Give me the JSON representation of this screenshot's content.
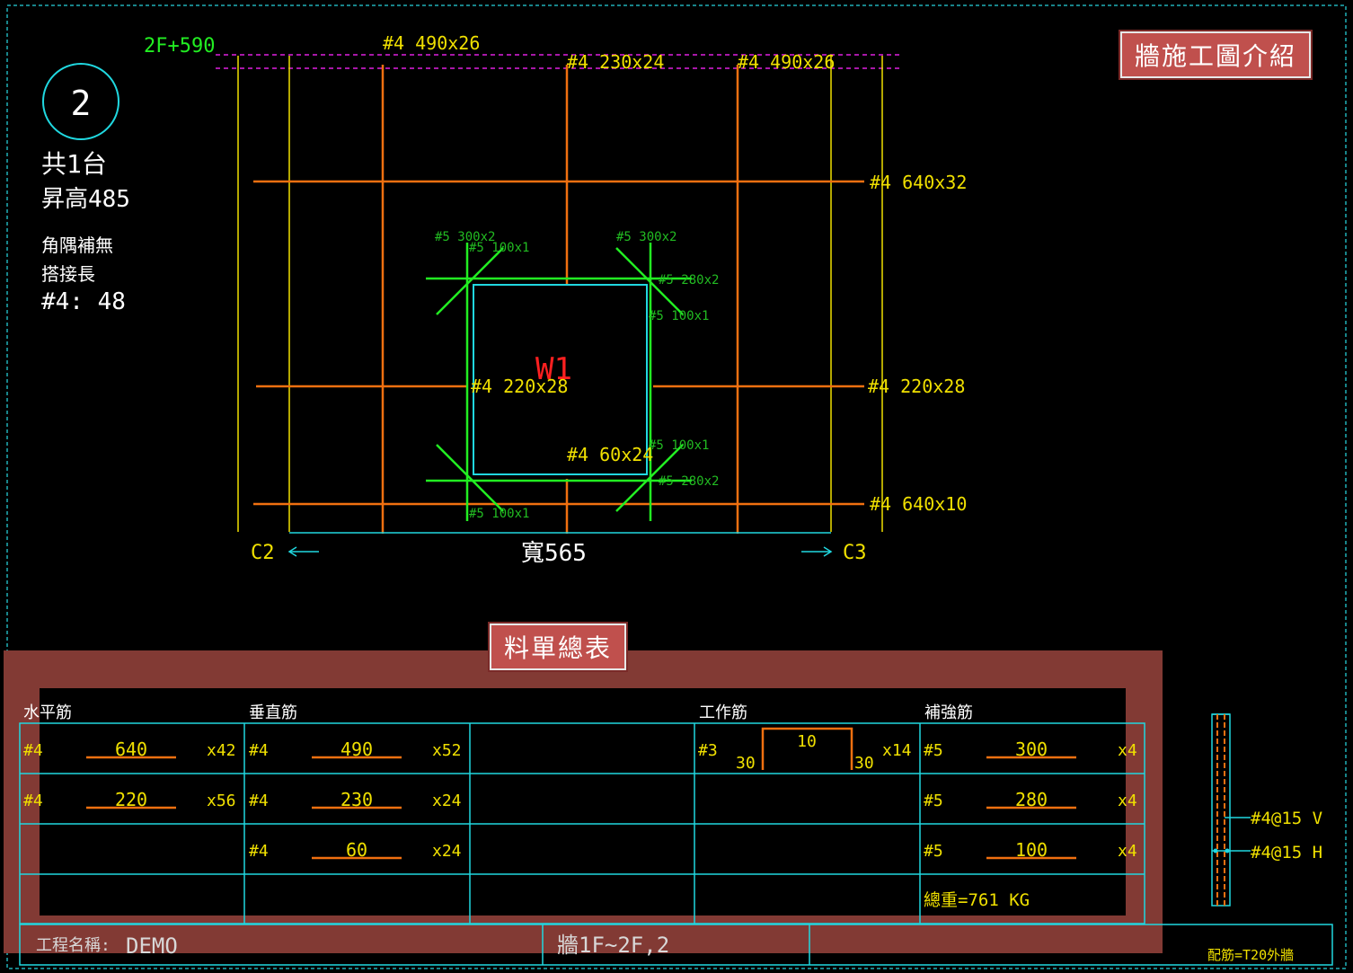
{
  "colors": {
    "bg": "#000000",
    "yellow": "#f0e000",
    "orange": "#f07010",
    "green": "#22ee22",
    "cyan": "#20d8e0",
    "white": "#ffffff",
    "magenta": "#e020e0",
    "red": "#ff2020",
    "panel": "#823a34",
    "label_bg": "#c0504d"
  },
  "labels": {
    "title_box": "牆施工圖介紹",
    "table_box": "料單總表"
  },
  "wall": {
    "level_label": "2F+590",
    "circle_number": "2",
    "count": "共1台",
    "height": "昇高485",
    "corner": "角隅補無",
    "lap_title": "搭接長",
    "lap_value": "#4:  48",
    "name": "W1",
    "width_label": "寬565",
    "left_col": "C2",
    "right_col": "C3"
  },
  "rebar_top": [
    "#4 490x26",
    "#4 230x24",
    "#4 490x26"
  ],
  "rebar_right": [
    "#4 640x32",
    "#4 220x28",
    "#4 640x10"
  ],
  "rebar_inner": {
    "h": "#4 220x28",
    "v": "#4 60x24"
  },
  "rebar_small": {
    "tl1": "#5 300x2",
    "tl2": "#5 100x1",
    "tr1": "#5 300x2",
    "tr2": "#5 280x2",
    "tr3": "#5 100x1",
    "br1": "#5 100x1",
    "br2": "#5 280x2",
    "bl1": "#5 100x1"
  },
  "table": {
    "headers": [
      "水平筋",
      "垂直筋",
      "工作筋",
      "補強筋"
    ],
    "horizontal": [
      {
        "size": "#4",
        "len": "640",
        "qty": "x42"
      },
      {
        "size": "#4",
        "len": "220",
        "qty": "x56"
      }
    ],
    "vertical": [
      {
        "size": "#4",
        "len": "490",
        "qty": "x52"
      },
      {
        "size": "#4",
        "len": "230",
        "qty": "x24"
      },
      {
        "size": "#4",
        "len": "60",
        "qty": "x24"
      }
    ],
    "work": {
      "size": "#3",
      "left": "30",
      "top": "10",
      "right": "30",
      "qty": "x14"
    },
    "reinforce": [
      {
        "size": "#5",
        "len": "300",
        "qty": "x4"
      },
      {
        "size": "#5",
        "len": "280",
        "qty": "x4"
      },
      {
        "size": "#5",
        "len": "100",
        "qty": "x4"
      }
    ],
    "total": "總重=761 KG"
  },
  "footer": {
    "project_label": "工程名稱:",
    "project_value": "DEMO",
    "drawing": "牆1F~2F,2",
    "mix": "配筋=T20外牆"
  },
  "section": {
    "v": "#4@15 V",
    "h": "#4@15 H"
  }
}
